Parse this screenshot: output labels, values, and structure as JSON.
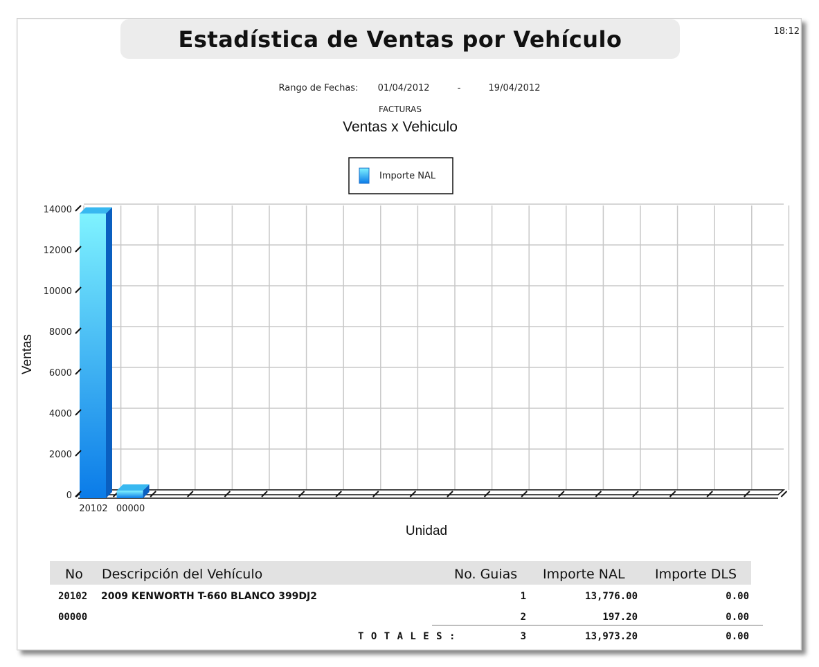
{
  "header": {
    "title": "Estadística de Ventas por Vehículo",
    "time": "18:12",
    "range_label": "Rango de Fechas:",
    "date_from": "01/04/2012",
    "separator": "-",
    "date_to": "19/04/2012",
    "document_type": "FACTURAS"
  },
  "chart_data": {
    "type": "bar",
    "title": "Ventas x Vehiculo",
    "xlabel": "Unidad",
    "ylabel": "Ventas",
    "ylim": [
      0,
      14000
    ],
    "yticks": [
      0,
      2000,
      4000,
      6000,
      8000,
      10000,
      12000,
      14000
    ],
    "categories": [
      "20102",
      "00000"
    ],
    "series": [
      {
        "name": "Importe NAL",
        "values": [
          13776.0,
          197.2
        ]
      }
    ],
    "legend": "top-center",
    "grid": true,
    "colors": {
      "bar_light": "#7ff3ff",
      "bar_dark": "#0a7be8",
      "grid": "#c8c8c8"
    }
  },
  "table": {
    "headers": {
      "no": "No",
      "description": "Descripción del Vehículo",
      "guias": "No. Guias",
      "nal": "Importe NAL",
      "dls": "Importe DLS"
    },
    "rows": [
      {
        "no": "20102",
        "description": "2009 KENWORTH T-660 BLANCO 399DJ2",
        "guias": "1",
        "nal": "13,776.00",
        "dls": "0.00"
      },
      {
        "no": "00000",
        "description": "",
        "guias": "2",
        "nal": "197.20",
        "dls": "0.00"
      }
    ],
    "totals": {
      "label": "T O T A L E S :",
      "guias": "3",
      "nal": "13,973.20",
      "dls": "0.00"
    }
  }
}
